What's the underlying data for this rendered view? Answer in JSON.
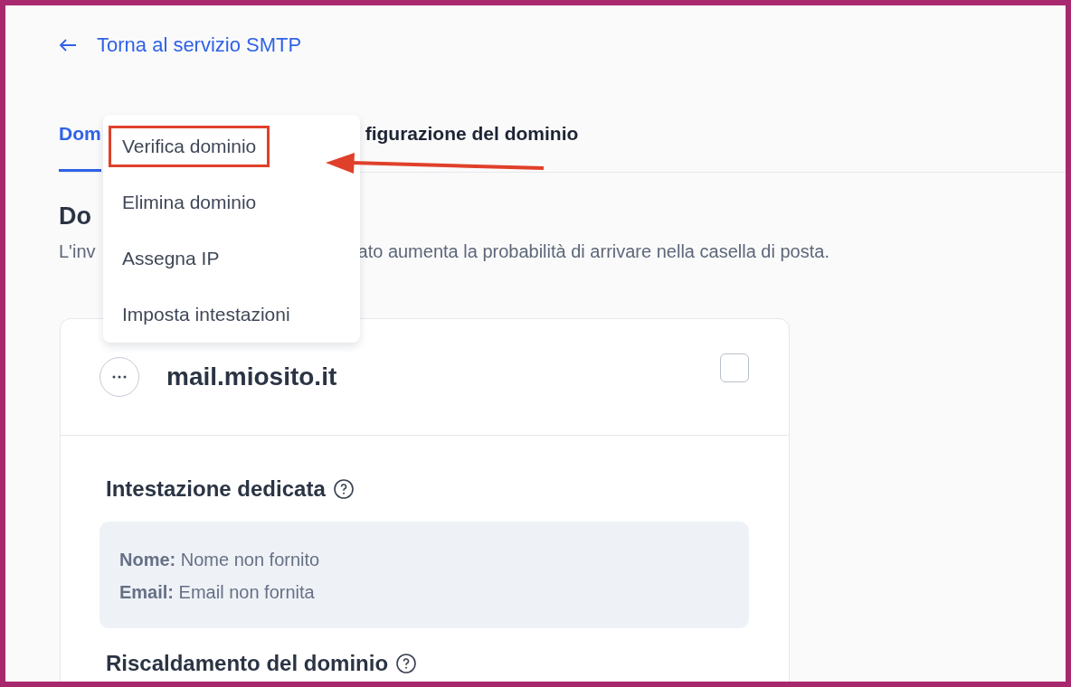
{
  "back_link": {
    "label": "Torna al servizio SMTP"
  },
  "tabs": [
    {
      "label": "Dom",
      "selected": true
    },
    {
      "label": "figurazione del dominio",
      "selected": false
    }
  ],
  "section": {
    "heading": "Do",
    "description_start": "L'inv",
    "description_end": "ato aumenta la probabilità di arrivare nella casella di posta."
  },
  "menu": {
    "items": [
      {
        "label": "Verifica dominio",
        "highlighted": true
      },
      {
        "label": "Elimina dominio",
        "highlighted": false
      },
      {
        "label": "Assegna IP",
        "highlighted": false
      },
      {
        "label": "Imposta intestazioni",
        "highlighted": false
      }
    ]
  },
  "domain_card": {
    "domain": "mail.miosito.it",
    "checked": false,
    "header_section": {
      "title": "Intestazione dedicata",
      "lines": [
        "**Nome:** Nome non fornito",
        "**Email:** Email non fornita"
      ]
    },
    "warmup_section": {
      "title": "Riscaldamento del dominio"
    }
  }
}
